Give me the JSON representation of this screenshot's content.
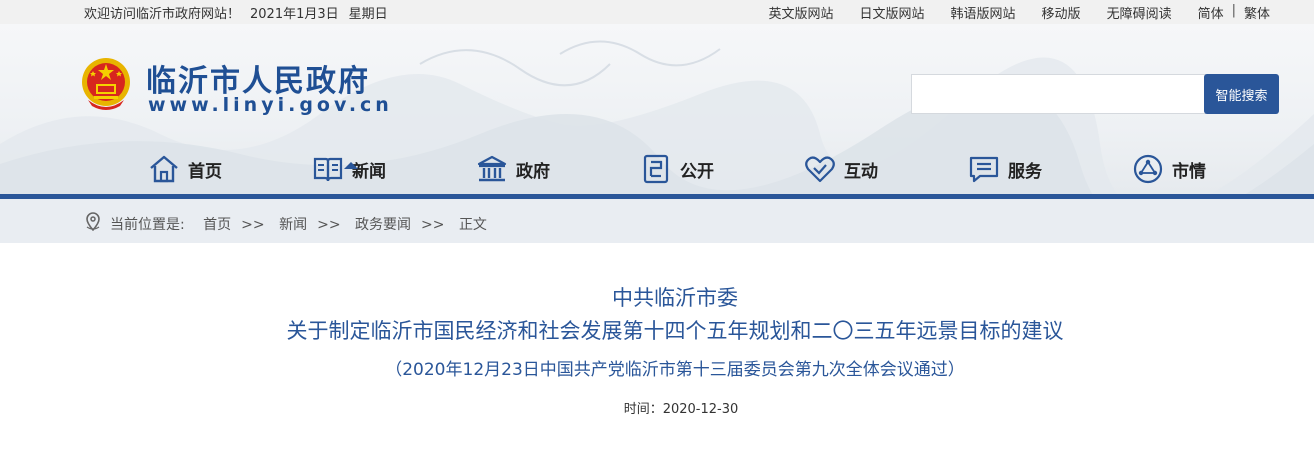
{
  "topbar": {
    "welcome": "欢迎访问临沂市政府网站！",
    "date": "2021年1月3日",
    "weekday": "星期日",
    "links": [
      "英文版网站",
      "日文版网站",
      "韩语版网站",
      "移动版",
      "无障碍阅读",
      "简体"
    ],
    "separator": "|",
    "traditional": "繁体"
  },
  "header": {
    "title": "临沂市人民政府",
    "url": "www.linyi.gov.cn",
    "search_placeholder": "",
    "search_button": "智能搜索"
  },
  "nav": {
    "items": [
      {
        "label": "首页",
        "icon": "home-icon"
      },
      {
        "label": "新闻",
        "icon": "news-icon",
        "active": true
      },
      {
        "label": "政府",
        "icon": "government-icon"
      },
      {
        "label": "公开",
        "icon": "disclosure-icon"
      },
      {
        "label": "互动",
        "icon": "interaction-icon"
      },
      {
        "label": "服务",
        "icon": "service-icon"
      },
      {
        "label": "市情",
        "icon": "city-info-icon"
      }
    ]
  },
  "breadcrumb": {
    "prefix": "当前位置是:",
    "items": [
      "首页",
      "新闻",
      "政务要闻",
      "正文"
    ],
    "separator": ">>"
  },
  "article": {
    "title_line1": "中共临沂市委",
    "title_line2": "关于制定临沂市国民经济和社会发展第十四个五年规划和二〇三五年远景目标的建议",
    "subtitle": "（2020年12月23日中国共产党临沂市第十三届委员会第九次全体会议通过）",
    "time_label": "时间：",
    "time_value": "2020-12-30"
  },
  "colors": {
    "brand": "#2a5699",
    "title": "#1f4f94",
    "topbar_bg": "#f1f1f1",
    "breadcrumb_bg": "#e9edf2"
  }
}
